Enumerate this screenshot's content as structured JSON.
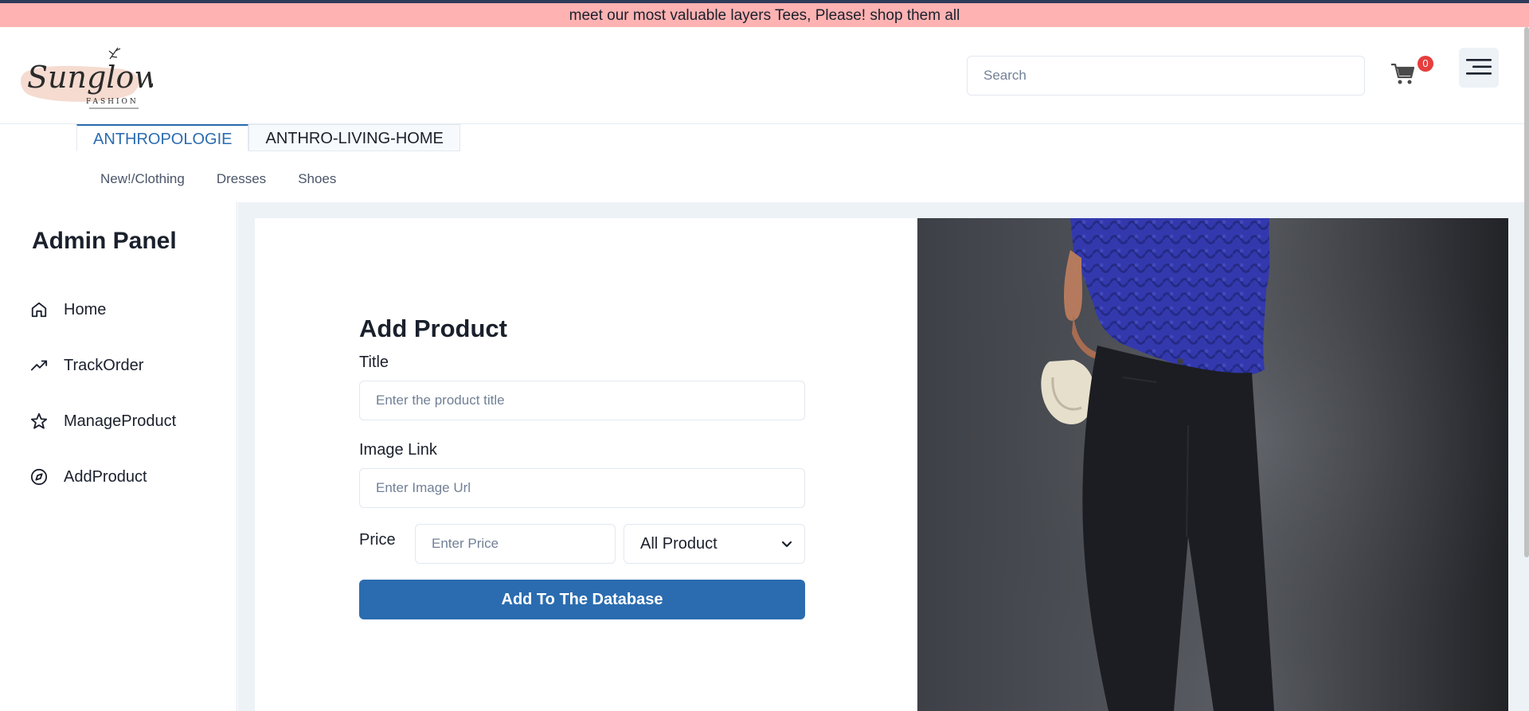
{
  "announcement": "meet our most valuable layers Tees, Please! shop them all",
  "logo": {
    "brand": "Sunglow",
    "sub": "FASHION"
  },
  "search": {
    "placeholder": "Search"
  },
  "cart": {
    "count": "0"
  },
  "tabs": [
    {
      "label": "ANTHROPOLOGIE",
      "active": true
    },
    {
      "label": "ANTHRO-LIVING-HOME",
      "active": false
    }
  ],
  "subnav": [
    "New!/Clothing",
    "Dresses",
    "Shoes"
  ],
  "sidebar": {
    "title": "Admin Panel",
    "items": [
      {
        "label": "Home",
        "icon": "home-icon"
      },
      {
        "label": "TrackOrder",
        "icon": "trending-up-icon"
      },
      {
        "label": "ManageProduct",
        "icon": "star-icon"
      },
      {
        "label": "AddProduct",
        "icon": "compass-icon"
      }
    ]
  },
  "form": {
    "title": "Add Product",
    "title_label": "Title",
    "title_placeholder": "Enter the product title",
    "image_label": "Image Link",
    "image_placeholder": "Enter Image Url",
    "price_label": "Price",
    "price_placeholder": "Enter Price",
    "category_value": "All Product",
    "submit_label": "Add To The Database"
  },
  "colors": {
    "announcement_bg": "#feb2b2",
    "accent": "#2b6cb0",
    "badge": "#e53e3e",
    "sweater": "#3137a8"
  }
}
